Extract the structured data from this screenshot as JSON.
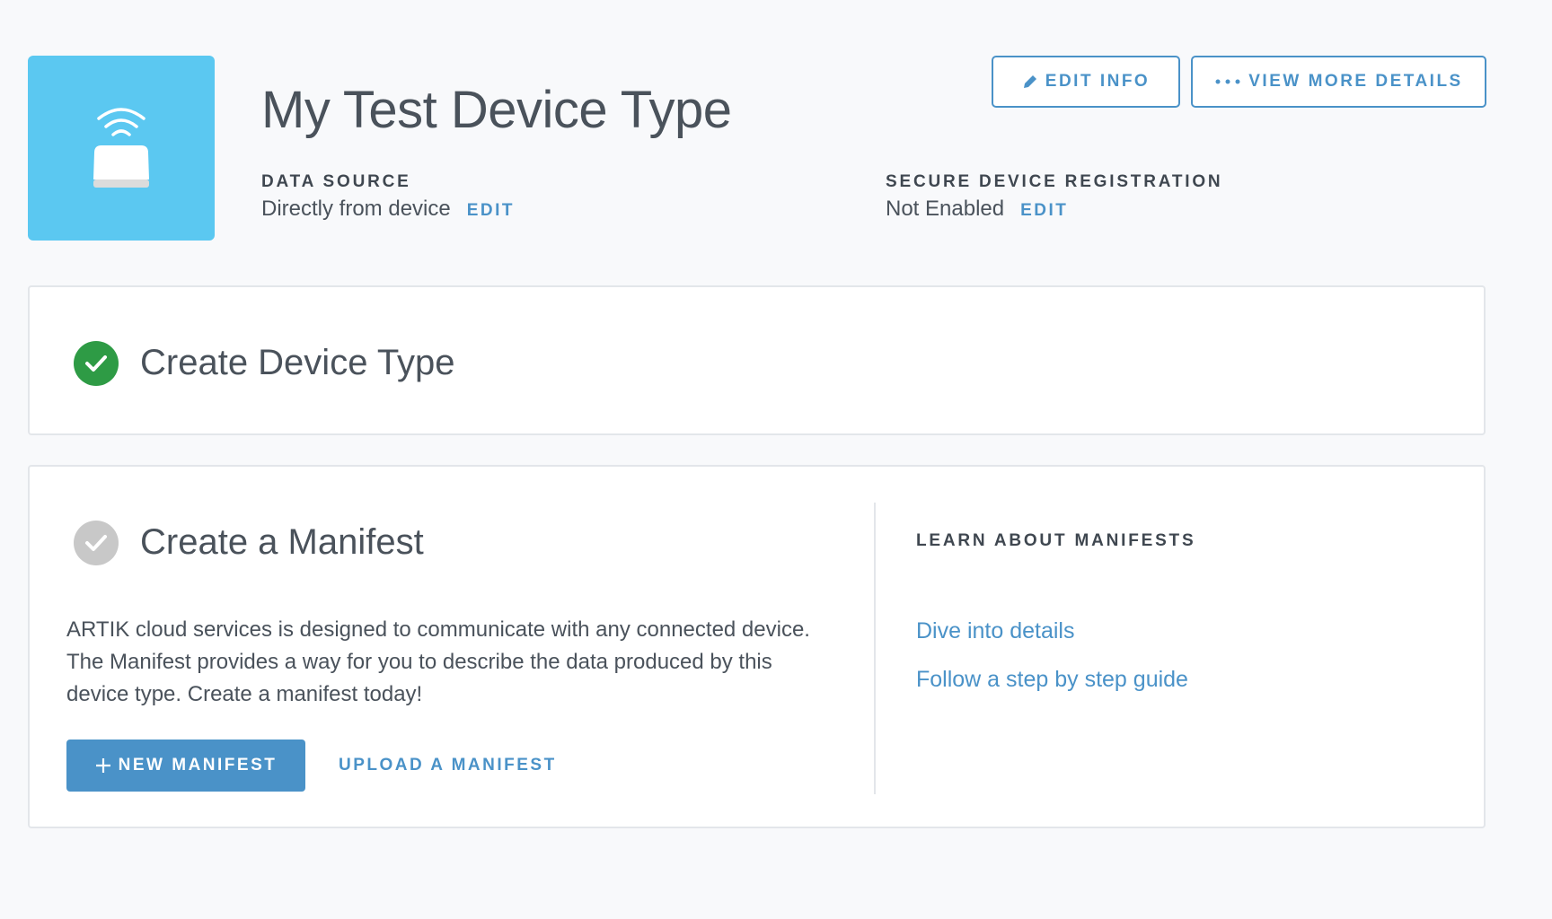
{
  "header": {
    "title": "My Test Device Type",
    "edit_info_label": "EDIT INFO",
    "view_more_label": "VIEW MORE DETAILS",
    "device_icon": "router-wifi-icon",
    "tile_color": "#5bc8f1"
  },
  "meta": {
    "data_source": {
      "label": "DATA SOURCE",
      "value": "Directly from device",
      "edit_label": "EDIT"
    },
    "secure_registration": {
      "label": "SECURE DEVICE REGISTRATION",
      "value": "Not Enabled",
      "edit_label": "EDIT"
    }
  },
  "steps": [
    {
      "title": "Create Device Type",
      "status": "complete",
      "icon": "check-circle-icon",
      "color": "#2e9b45"
    },
    {
      "title": "Create a Manifest",
      "status": "incomplete",
      "icon": "check-circle-icon",
      "color": "#c8c8c8",
      "description": "ARTIK cloud services is designed to communicate with any connected device. The Manifest provides a way for you to describe the data produced by this device type. Create a manifest today!",
      "new_manifest_label": "NEW MANIFEST",
      "upload_manifest_label": "UPLOAD A MANIFEST",
      "learn": {
        "label": "LEARN ABOUT MANIFESTS",
        "links": [
          "Dive into details",
          "Follow a step by step guide"
        ]
      }
    }
  ],
  "colors": {
    "accent": "#4a92c8",
    "background": "#f8f9fb",
    "text": "#4a525b"
  }
}
